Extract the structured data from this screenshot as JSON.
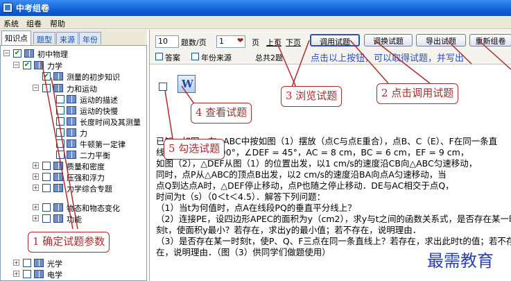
{
  "window": {
    "title": "中考组卷"
  },
  "menu": [
    "系统",
    "组卷",
    "帮助"
  ],
  "left_tabs": [
    "知识点",
    "题型",
    "来源",
    "年份"
  ],
  "tree": [
    {
      "label": "初中物理",
      "level": 0,
      "checked": true
    },
    {
      "label": "力学",
      "level": 1,
      "checked": true
    },
    {
      "label": "测量的初步知识",
      "level": 2,
      "checked": true
    },
    {
      "label": "力和运动",
      "level": 2,
      "checked": false
    },
    {
      "label": "运动的描述",
      "level": 3,
      "checked": false
    },
    {
      "label": "运动的快慢",
      "level": 3,
      "checked": false
    },
    {
      "label": "长度时间及其测量",
      "level": 3,
      "checked": false
    },
    {
      "label": "力",
      "level": 3,
      "checked": false
    },
    {
      "label": "牛顿第一定律",
      "level": 3,
      "checked": false
    },
    {
      "label": "二力平衡",
      "level": 3,
      "checked": false
    },
    {
      "label": "质量和密度",
      "level": 2,
      "checked": false
    },
    {
      "label": "压强和浮力",
      "level": 2,
      "checked": false
    },
    {
      "label": "力学综合专题",
      "level": 2,
      "checked": false
    },
    {
      "label": "物态和物态变化",
      "level": 2,
      "checked": false
    },
    {
      "label": "功能",
      "level": 2,
      "checked": false
    },
    {
      "label": "光学",
      "level": 1,
      "checked": false
    },
    {
      "label": "电学",
      "level": 1,
      "checked": false
    }
  ],
  "toolbar": {
    "per_page_value": "10",
    "per_page_label": "题数/页",
    "page_value": "1",
    "page_label": "页",
    "prev_page": "上页",
    "next_page": "下页",
    "buttons": [
      "调用试题",
      "调换试题",
      "导出试题",
      "重新组卷"
    ],
    "answer_label": "答案",
    "year_source_label": "年份来源",
    "total_label": "总共2题",
    "hint": "点击以上按钮，可以取得试题，并写出"
  },
  "question_lines": [
    "已知：如图，在△ABC中按如图（1）摆放（点C与点E重合），点B、C（E）、F在同一条直",
    "线上，∠ACB = 90°，∠DEF = 45°，AC = 8 cm，BC = 6 cm，EF = 9 cm，",
    "如图（2），△DEF从图（1）的位置出发，以1 cm/s的速度沿CB向△ABC匀速移动，",
    "同时，点P从△ABC的顶点B出发，以2 cm/s的速度沿BA向点A匀速移动，当",
    "点Q到达点A时，△DEF停止移动，点P也随之停止移动．DE与AC相交于点Q，",
    "时间为t（s）（0＜t＜4.5）．解答下列问题：",
    "（1）当t为何值时，点A在线段PQ的垂直平分线上？",
    "（2）连接PE，设四边形APEC的面积为y（cm2），求y与t之间的函数关系式，是否存在某一时",
    "刻t，使面积y最小？若存在，求出y的最小值；若不存在，说明理由．",
    "（3）是否存在某一时刻t，使P、Q、F三点在同一条直线上？若存在，求出此时t的值；若不存",
    "在，说明理由．（图（3）供同学们做题使用）"
  ],
  "callouts": [
    "1 确定试题参数",
    "2 点击调用试题",
    "3 浏览试题",
    "4 查看试题",
    "5 勾选试题"
  ],
  "watermark": "最需教育"
}
